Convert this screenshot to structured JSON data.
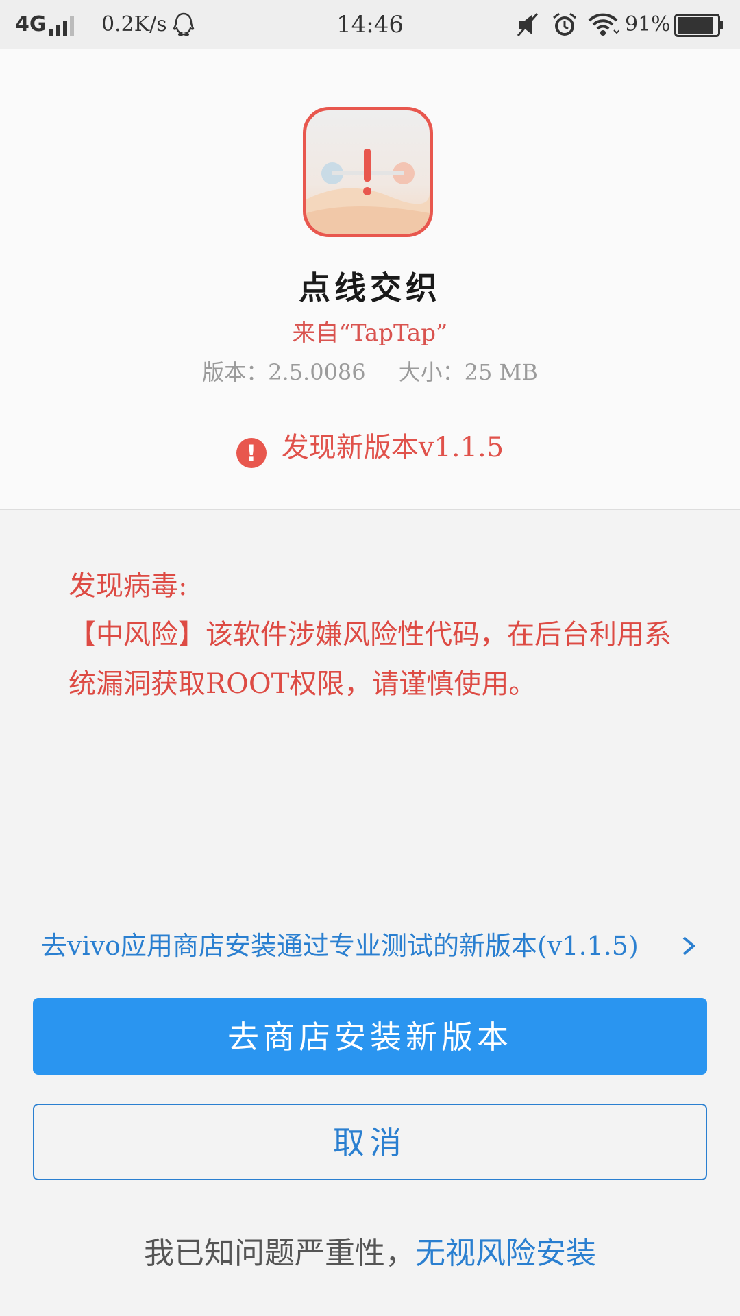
{
  "status_bar": {
    "network": "4G",
    "speed": "0.2K/s",
    "time": "14:46",
    "battery_percent": "91%",
    "battery_level": 0.91,
    "icons": [
      "signal-icon",
      "qq-icon",
      "mute-icon",
      "alarm-icon",
      "wifi-icon",
      "battery-icon"
    ]
  },
  "app": {
    "name": "点线交织",
    "source": "来自“TapTap”",
    "version_label": "版本：2.5.0086",
    "size_label": "大小：25 MB",
    "update_notice": "发现新版本v1.1.5",
    "warn_glyph": "!"
  },
  "warning": {
    "title": "发现病毒:",
    "description": "【中风险】该软件涉嫌风险性代码，在后台利用系统漏洞获取ROOT权限，请谨慎使用。"
  },
  "actions": {
    "store_link": "去vivo应用商店安装通过专业测试的新版本(v1.1.5)",
    "primary_button": "去商店安装新版本",
    "cancel_button": "取消",
    "ignore_prefix": "我已知问题严重性，",
    "ignore_link": "无视风险安装"
  },
  "colors": {
    "accent_blue": "#2a95f0",
    "link_blue": "#2a7fd0",
    "danger_red": "#e8574e"
  }
}
